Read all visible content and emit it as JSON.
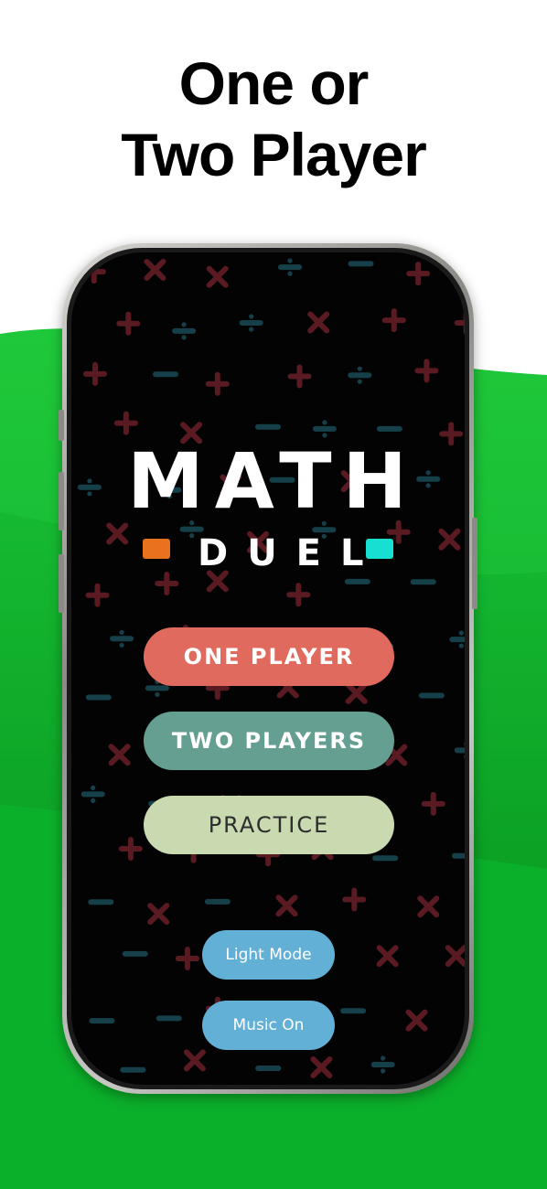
{
  "headline": {
    "line1": "One or",
    "line2": "Two Player"
  },
  "app": {
    "logo_title": "MATH",
    "logo_subtitle": "DUEL",
    "colors": {
      "screen_background": "#030303",
      "symbol": "#5a1a22",
      "symbol_alt": "#15404a",
      "accent_orange": "#e8721d",
      "accent_cyan": "#17e0d3"
    },
    "buttons": {
      "one_player": "ONE PLAYER",
      "two_players": "TWO PLAYERS",
      "practice": "PRACTICE",
      "light_mode": "Light Mode",
      "music": "Music On"
    }
  },
  "theme": {
    "green_light": "#22c93a",
    "green_dark": "#0a9f23",
    "button_one": "#e06a5e",
    "button_two": "#649f92",
    "button_practice": "#c9d9b0",
    "button_small": "#63b0d6"
  }
}
